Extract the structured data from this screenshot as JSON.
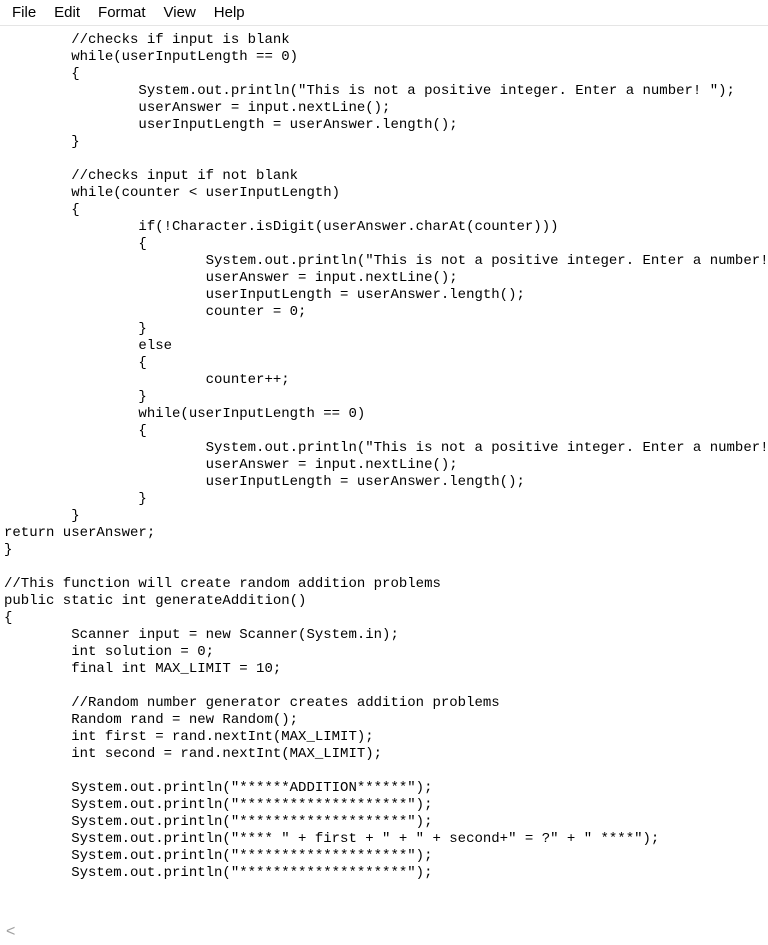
{
  "menubar": {
    "items": [
      "File",
      "Edit",
      "Format",
      "View",
      "Help"
    ]
  },
  "code_lines": [
    "        //checks if input is blank",
    "        while(userInputLength == 0)",
    "        {",
    "                System.out.println(\"This is not a positive integer. Enter a number! \");",
    "                userAnswer = input.nextLine();",
    "                userInputLength = userAnswer.length();",
    "        }",
    "",
    "        //checks input if not blank",
    "        while(counter < userInputLength)",
    "        {",
    "                if(!Character.isDigit(userAnswer.charAt(counter)))",
    "                {",
    "                        System.out.println(\"This is not a positive integer. Enter a number! \");",
    "                        userAnswer = input.nextLine();",
    "                        userInputLength = userAnswer.length();",
    "                        counter = 0;",
    "                }",
    "                else",
    "                {",
    "                        counter++;",
    "                }",
    "                while(userInputLength == 0)",
    "                {",
    "                        System.out.println(\"This is not a positive integer. Enter a number!\");",
    "                        userAnswer = input.nextLine();",
    "                        userInputLength = userAnswer.length();",
    "                }",
    "        }",
    "return userAnswer;",
    "}",
    "",
    "//This function will create random addition problems",
    "public static int generateAddition()",
    "{",
    "        Scanner input = new Scanner(System.in);",
    "        int solution = 0;",
    "        final int MAX_LIMIT = 10;",
    "",
    "        //Random number generator creates addition problems",
    "        Random rand = new Random();",
    "        int first = rand.nextInt(MAX_LIMIT);",
    "        int second = rand.nextInt(MAX_LIMIT);",
    "",
    "        System.out.println(\"******ADDITION******\");",
    "        System.out.println(\"********************\");",
    "        System.out.println(\"********************\");",
    "        System.out.println(\"**** \" + first + \" + \" + second+\" = ?\" + \" ****\");",
    "        System.out.println(\"********************\");",
    "        System.out.println(\"********************\");"
  ],
  "scroll_indicator": "<"
}
